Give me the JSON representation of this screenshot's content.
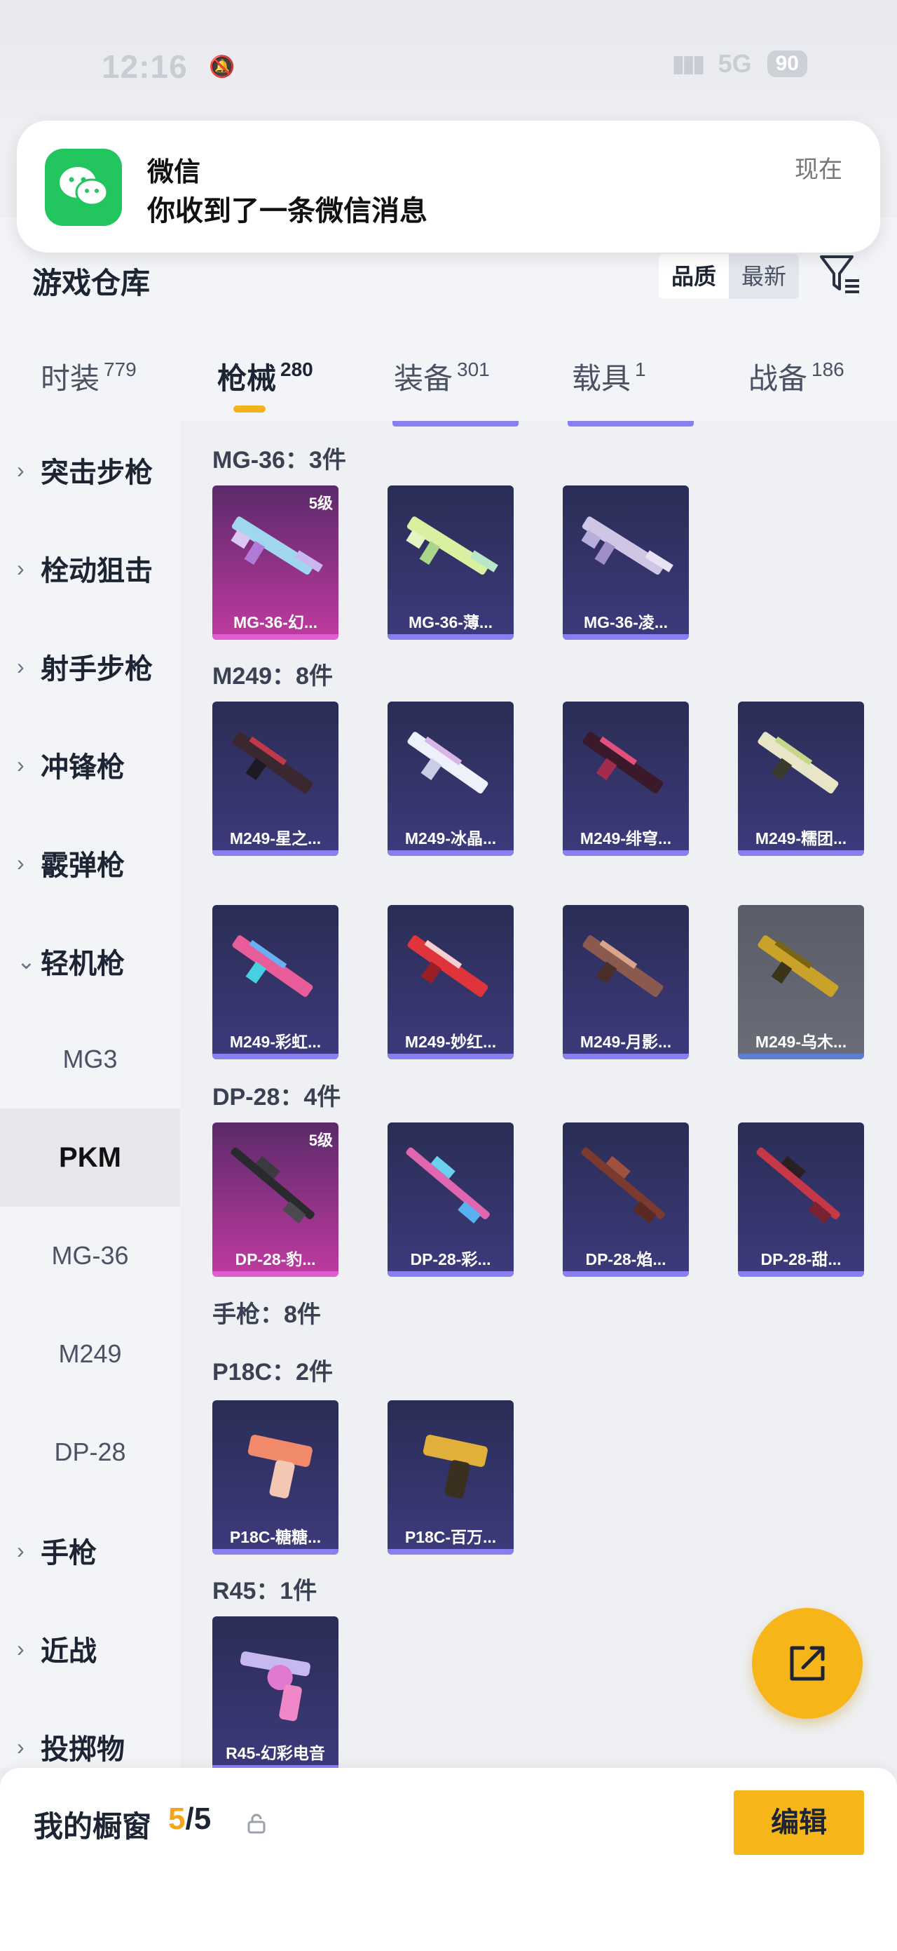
{
  "status_bar": {
    "time": "12:16",
    "network": "5G",
    "battery": "90"
  },
  "notification": {
    "app": "微信",
    "message": "你收到了一条微信消息",
    "time": "现在"
  },
  "header": {
    "title": "游戏仓库",
    "sort_quality": "品质",
    "sort_newest": "最新"
  },
  "tabs": [
    {
      "label": "时装",
      "count": "779"
    },
    {
      "label": "枪械",
      "count": "280"
    },
    {
      "label": "装备",
      "count": "301"
    },
    {
      "label": "载具",
      "count": "1"
    },
    {
      "label": "战备",
      "count": "186"
    }
  ],
  "sidebar": [
    {
      "label": "突击步枪"
    },
    {
      "label": "栓动狙击"
    },
    {
      "label": "射手步枪"
    },
    {
      "label": "冲锋枪"
    },
    {
      "label": "霰弹枪"
    },
    {
      "label": "轻机枪"
    },
    {
      "label": "MG3"
    },
    {
      "label": "PKM"
    },
    {
      "label": "MG-36"
    },
    {
      "label": "M249"
    },
    {
      "label": "DP-28"
    },
    {
      "label": "手枪"
    },
    {
      "label": "近战"
    },
    {
      "label": "投掷物"
    }
  ],
  "groups": {
    "mg36": {
      "title": "MG-36：3件"
    },
    "m249": {
      "title": "M249：8件"
    },
    "dp28": {
      "title": "DP-28：4件"
    },
    "pistol": {
      "title": "手枪：8件"
    },
    "p18c": {
      "title": "P18C：2件"
    },
    "r45": {
      "title": "R45：1件"
    }
  },
  "cards": {
    "mg36_1": {
      "name": "MG-36-幻...",
      "level": "5级"
    },
    "mg36_2": {
      "name": "MG-36-薄..."
    },
    "mg36_3": {
      "name": "MG-36-凌..."
    },
    "m249_1": {
      "name": "M249-星之..."
    },
    "m249_2": {
      "name": "M249-冰晶..."
    },
    "m249_3": {
      "name": "M249-绯穹..."
    },
    "m249_4": {
      "name": "M249-糯团..."
    },
    "m249_5": {
      "name": "M249-彩虹..."
    },
    "m249_6": {
      "name": "M249-妙红..."
    },
    "m249_7": {
      "name": "M249-月影..."
    },
    "m249_8": {
      "name": "M249-乌木..."
    },
    "dp28_1": {
      "name": "DP-28-豹...",
      "level": "5级"
    },
    "dp28_2": {
      "name": "DP-28-彩..."
    },
    "dp28_3": {
      "name": "DP-28-焰..."
    },
    "dp28_4": {
      "name": "DP-28-甜..."
    },
    "p18c_1": {
      "name": "P18C-糖糖..."
    },
    "p18c_2": {
      "name": "P18C-百万..."
    },
    "r45_1": {
      "name": "R45-幻彩电音"
    }
  },
  "showcase": {
    "title": "我的橱窗",
    "current": "5",
    "total": "/5",
    "edit_label": "编辑"
  },
  "colors": {
    "accent": "#f6b619",
    "card_purple": "#3d3a7c",
    "card_pink": "#c03aa0"
  }
}
